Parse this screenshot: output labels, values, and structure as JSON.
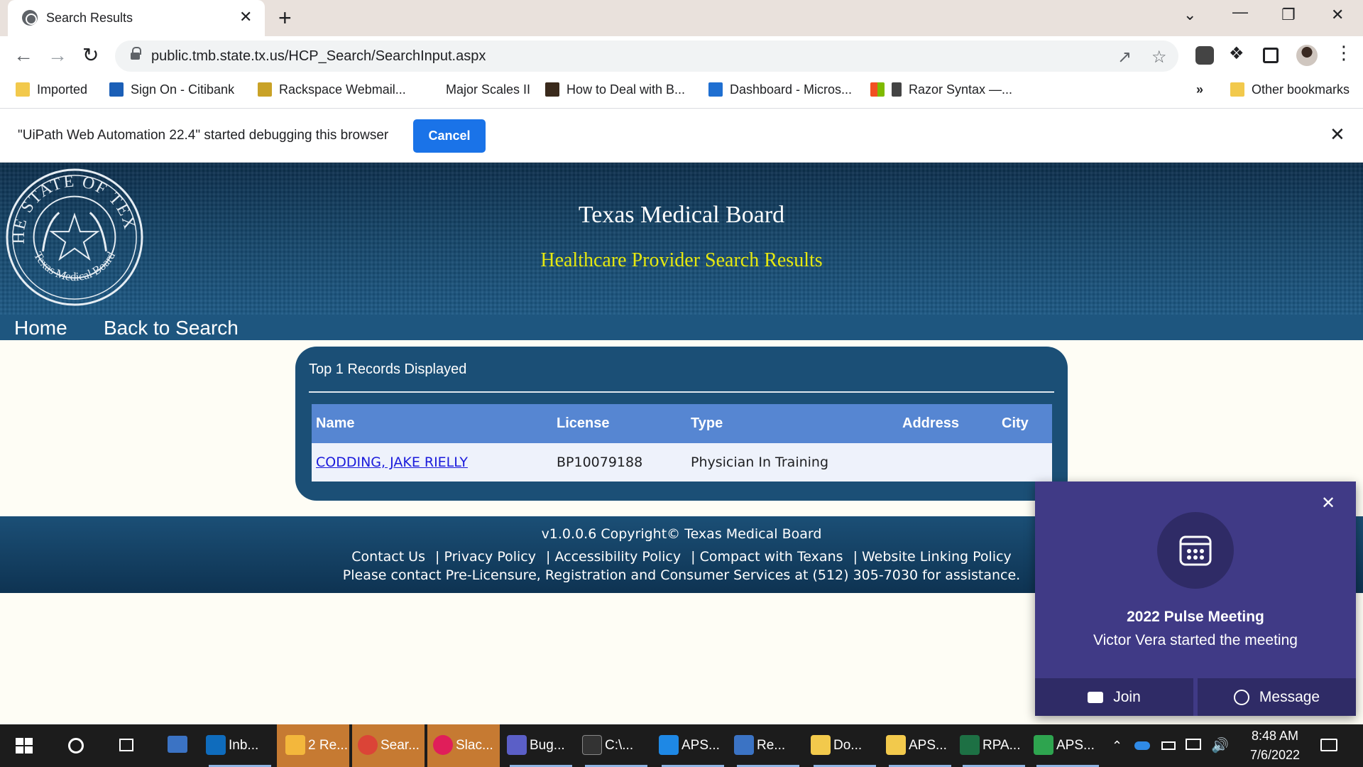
{
  "browser": {
    "tab_title": "Search Results",
    "tab_close": "✕",
    "new_tab": "+",
    "url": "public.tmb.state.tx.us/HCP_Search/SearchInput.aspx",
    "window_controls": {
      "tab_search": "⌄",
      "minimize": "—",
      "restore": "❐",
      "close": "✕"
    },
    "bookmarks": [
      {
        "label": "Imported",
        "icon": "folder-icon",
        "color": "#f2c94c"
      },
      {
        "label": "Sign On - Citibank",
        "icon": "citi-icon",
        "color": "#1b5fb7"
      },
      {
        "label": "Rackspace Webmail...",
        "icon": "mail-icon",
        "color": "#c9a227"
      },
      {
        "label": "Major Scales II",
        "icon": "blank-icon",
        "color": "#ffffff"
      },
      {
        "label": "How to Deal with B...",
        "icon": "page-icon",
        "color": "#3a2a1c"
      },
      {
        "label": "Dashboard - Micros...",
        "icon": "azure-icon",
        "color": "#1f6fd1"
      },
      {
        "label": "Razor Syntax —...",
        "icon": "pen-icon",
        "color": "#444444"
      }
    ],
    "overflow": "»",
    "other_bookmarks": "Other bookmarks"
  },
  "infobar": {
    "message": "\"UiPath Web Automation 22.4\" started debugging this browser",
    "cancel_label": "Cancel",
    "close": "✕"
  },
  "header": {
    "title": "Texas Medical Board",
    "subtitle": "Healthcare Provider Search Results",
    "seal_text_top": "THE STATE OF TEXAS",
    "seal_text_bottom": "Texas Medical Board"
  },
  "nav": {
    "home": "Home",
    "back": "Back to Search"
  },
  "results": {
    "caption": "Top 1 Records Displayed",
    "columns": [
      "Name",
      "License",
      "Type",
      "Address",
      "City"
    ],
    "rows": [
      {
        "name": "CODDING, JAKE RIELLY",
        "license": "BP10079188",
        "type": "Physician In Training",
        "address": "",
        "city": ""
      }
    ]
  },
  "footer": {
    "version": "v1.0.0.6 Copyright© Texas Medical Board",
    "links": [
      "Contact Us",
      "| Privacy Policy",
      "| Accessibility Policy",
      "| Compact with Texans",
      "| Website Linking Policy"
    ],
    "contact": "Please contact Pre-Licensure, Registration and Consumer Services at (512) 305-7030 for assistance."
  },
  "toast": {
    "title": "2022 Pulse Meeting",
    "subtitle": "Victor Vera started the meeting",
    "join": "Join",
    "message": "Message",
    "close": "✕"
  },
  "taskbar": {
    "items": [
      {
        "label": "Inb...",
        "icon": "outlook-icon",
        "color": "#0f6cbd"
      },
      {
        "label": "2 Re...",
        "icon": "bell-icon",
        "color": "#f3b73c"
      },
      {
        "label": "Sear...",
        "icon": "chrome-icon",
        "color": "#db4437"
      },
      {
        "label": "Slac...",
        "icon": "slack-icon",
        "color": "#e01e5a"
      },
      {
        "label": "Bug...",
        "icon": "teams-icon",
        "color": "#5b5fc7"
      },
      {
        "label": "C:\\...",
        "icon": "terminal-icon",
        "color": "#333333"
      },
      {
        "label": "APS...",
        "icon": "s-icon",
        "color": "#1e88e5"
      },
      {
        "label": "Re...",
        "icon": "remote-icon",
        "color": "#3b73c4"
      },
      {
        "label": "Do...",
        "icon": "folder-icon",
        "color": "#f2c94c"
      },
      {
        "label": "APS...",
        "icon": "folder-icon",
        "color": "#f2c94c"
      },
      {
        "label": "RPA...",
        "icon": "excel-icon",
        "color": "#1d7044"
      },
      {
        "label": "APS...",
        "icon": "play-icon",
        "color": "#2ea44f"
      }
    ],
    "time": "8:48 AM",
    "date": "7/6/2022"
  }
}
